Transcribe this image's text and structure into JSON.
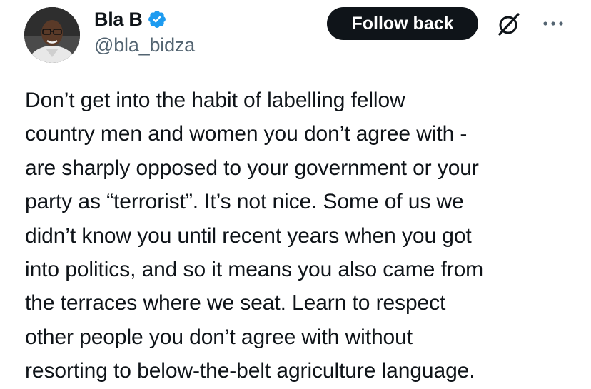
{
  "author": {
    "display_name": "Bla B",
    "handle": "@bla_bidza",
    "verified": true
  },
  "actions": {
    "follow_label": "Follow back"
  },
  "icons": {
    "avatar": "profile-photo",
    "verified": "verified-badge-icon",
    "grok": "grok-icon",
    "more": "more-options-icon"
  },
  "colors": {
    "text_primary": "#0f1419",
    "text_secondary": "#536471",
    "verified_blue": "#1d9bf0",
    "button_bg": "#0f1419",
    "button_text": "#ffffff"
  },
  "tweet": {
    "text": "Don’t get into the habit of labelling fellow\ncountry men and women you don’t agree with -\nare sharply opposed to your government or your\nparty as “terrorist”. It’s not nice. Some of us we\ndidn’t know you until recent years when you got\ninto politics, and so it means you also came from\nthe terraces where we seat. Learn to respect\nother people you don’t agree with without\nresorting to below-the-belt agriculture language."
  }
}
